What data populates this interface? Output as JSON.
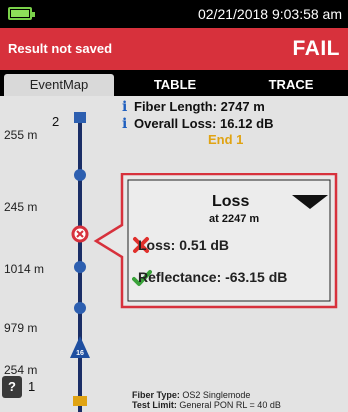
{
  "status_bar": {
    "datetime": "02/21/2018 9:03:58 am",
    "battery_color": "#8ee05a"
  },
  "result_bar": {
    "message": "Result not saved",
    "status": "FAIL",
    "color": "#d7313c"
  },
  "tabs": [
    {
      "label": "EventMap",
      "active": true
    },
    {
      "label": "TABLE",
      "active": false
    },
    {
      "label": "TRACE",
      "active": false
    }
  ],
  "summary": {
    "fiber_length": "Fiber Length:  2747 m",
    "overall_loss": "Overall Loss:  16.12 dB",
    "end_label": "End 1",
    "info_icon": "info-icon"
  },
  "map": {
    "end_marker": "2",
    "distances": [
      "255 m",
      "245 m",
      "1014 m",
      "979 m",
      "254 m"
    ],
    "splitter_label": "16"
  },
  "popup": {
    "title": "Loss",
    "subtitle": "at 2247 m",
    "loss_row": "Loss: 0.51 dB",
    "loss_icon": "fail-x-icon",
    "reflectance_row": "Reflectance: -63.15 dB",
    "reflectance_icon": "pass-check-icon",
    "border_color": "#d7313c"
  },
  "footer": {
    "fiber_type_label": "Fiber Type:",
    "fiber_type_value": "OS2 Singlemode",
    "test_limit_label": "Test Limit:",
    "test_limit_value": "General PON RL = 40 dB"
  },
  "bottom": {
    "help": "?",
    "page": "1"
  }
}
